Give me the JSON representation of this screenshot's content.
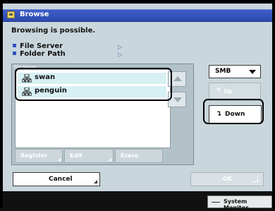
{
  "window": {
    "title": "Browse",
    "status": "Browsing is possible."
  },
  "info": [
    {
      "label": "File Server"
    },
    {
      "label": "Folder Path"
    }
  ],
  "list": {
    "header": "File Server",
    "items": [
      {
        "label": "swan",
        "icon": "network-computer-icon"
      },
      {
        "label": "penguin",
        "icon": "network-computer-icon"
      }
    ]
  },
  "list_buttons": {
    "register": "Register",
    "edit": "Edit",
    "erase": "Erase"
  },
  "protocol": {
    "selected": "SMB"
  },
  "nav": {
    "up": "Up",
    "down": "Down"
  },
  "footer": {
    "cancel": "Cancel",
    "ok": "OK"
  },
  "system_monitor": "System Monitor",
  "colors": {
    "titlebar": "#2d49ae",
    "bullet": "#2f52c4",
    "list_selected": "#d7f0f4",
    "screen_bg": "#c9d6dc"
  }
}
